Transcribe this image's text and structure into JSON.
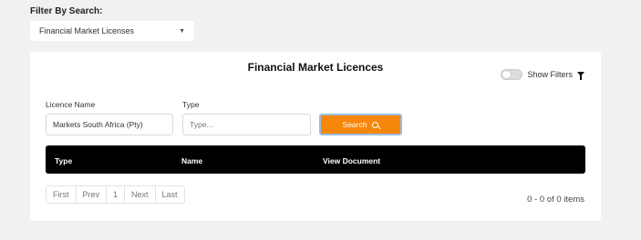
{
  "filter": {
    "label": "Filter By Search:",
    "selected": "Financial Market Licenses",
    "caret_icon": "caret-down"
  },
  "card": {
    "title": "Financial Market Licences",
    "show_filters_label": "Show Filters",
    "show_filters_on": false,
    "filter_icon": "funnel"
  },
  "form": {
    "licence_name_label": "Licence Name",
    "licence_name_value": "Markets South Africa (Pty)",
    "type_label": "Type",
    "type_placeholder": "Type...",
    "search_label": "Search",
    "search_icon": "magnifier"
  },
  "table": {
    "columns": [
      "Type",
      "Name",
      "View Document"
    ]
  },
  "pagination": {
    "first": "First",
    "prev": "Prev",
    "page": "1",
    "next": "Next",
    "last": "Last",
    "summary": "0 - 0 of 0 items"
  },
  "colors": {
    "accent": "#f7870b",
    "header_bg": "#000000",
    "page_bg": "#f1f1f1"
  }
}
